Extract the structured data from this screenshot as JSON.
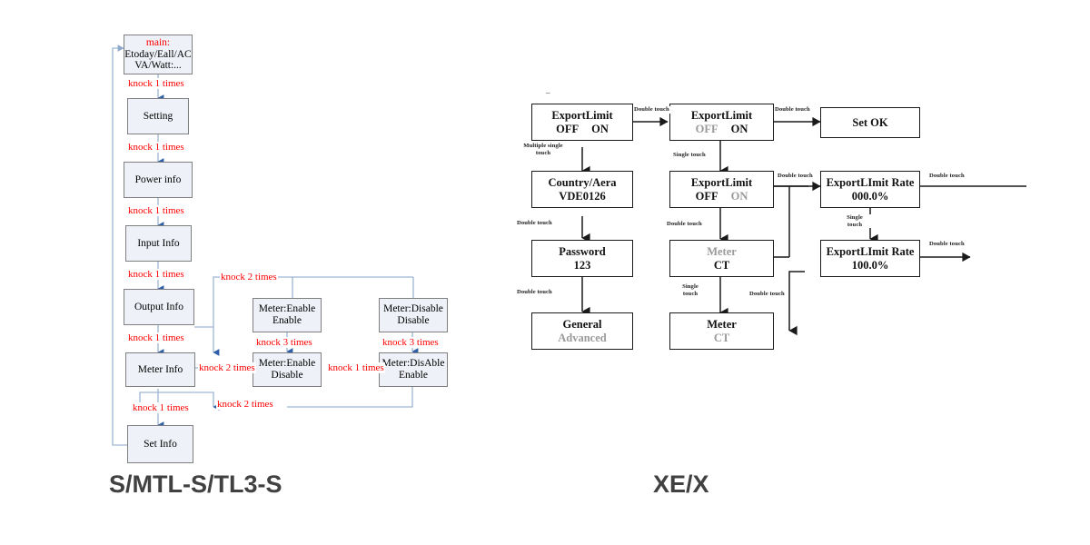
{
  "titles": {
    "left": "S/MTL-S/TL3-S",
    "right": "XE/X"
  },
  "left_chart": {
    "name": "S/MTL-S/TL3-S menu navigation flow",
    "boxes": [
      {
        "id": "main",
        "line1": "main:",
        "line2": "Etoday/Eall/AC",
        "line3": "VA/Watt:...",
        "line1_color": "#ff0000"
      },
      {
        "id": "setting",
        "line1": "Setting",
        "line2": "",
        "line3": ""
      },
      {
        "id": "power-info",
        "line1": "Power info",
        "line2": "",
        "line3": ""
      },
      {
        "id": "input-info",
        "line1": "Input Info",
        "line2": "",
        "line3": ""
      },
      {
        "id": "output-info",
        "line1": "Output Info",
        "line2": "",
        "line3": ""
      },
      {
        "id": "meter-info",
        "line1": "Meter  Info",
        "line2": "",
        "line3": ""
      },
      {
        "id": "set-info",
        "line1": "Set Info",
        "line2": "",
        "line3": ""
      },
      {
        "id": "meter-enable-enable",
        "line1": "Meter:Enable",
        "line2": "Enable",
        "line3": ""
      },
      {
        "id": "meter-enable-disable",
        "line1": "Meter:Enable",
        "line2": "Disable",
        "line3": ""
      },
      {
        "id": "meter-disable-disable",
        "line1": "Meter:Disable",
        "line2": "Disable",
        "line3": ""
      },
      {
        "id": "meter-disable-enable",
        "line1": "Meter:DisAble",
        "line2": "Enable",
        "line3": ""
      }
    ],
    "edge_labels": [
      {
        "id": "main-to-setting",
        "text": "knock 1 times"
      },
      {
        "id": "setting-to-power",
        "text": "knock 1 times"
      },
      {
        "id": "power-to-input",
        "text": "knock 1 times"
      },
      {
        "id": "input-to-output",
        "text": "knock 1 times"
      },
      {
        "id": "output-to-meter",
        "text": "knock 1 times"
      },
      {
        "id": "meter-to-set",
        "text": "knock 1 times"
      },
      {
        "id": "top-branch",
        "text": "knock 2 times"
      },
      {
        "id": "meterinfo-to-enabledisable",
        "text": "knock 2 times"
      },
      {
        "id": "enabledisable-to-disable",
        "text": "knock 1 times"
      },
      {
        "id": "enabledisable-up",
        "text": "knock 3 times"
      },
      {
        "id": "disableenable-up",
        "text": "knock 3 times"
      },
      {
        "id": "bottom-return",
        "text": "knock 2 times"
      }
    ],
    "accent_color": "#ff0000",
    "wire_color": "#9fb6d4",
    "box_fill": "#eef1f7",
    "box_border": "#7f7f7f"
  },
  "right_chart": {
    "name": "XE/X export limit setting flow",
    "boxes": [
      {
        "id": "exportlimit-1",
        "line1": "ExportLimit",
        "off": "OFF",
        "on": "ON",
        "off_dim": false,
        "on_dim": false
      },
      {
        "id": "exportlimit-2",
        "line1": "ExportLimit",
        "off": "OFF",
        "on": "ON",
        "off_dim": true,
        "on_dim": false
      },
      {
        "id": "set-ok",
        "line1": "Set OK",
        "line2": ""
      },
      {
        "id": "country-aera",
        "line1": "Country/Aera",
        "line2": "VDE0126"
      },
      {
        "id": "exportlimit-3",
        "line1": "ExportLimit",
        "off": "OFF",
        "on": "ON",
        "off_dim": false,
        "on_dim": true
      },
      {
        "id": "rate-000",
        "line1": "ExportLImit Rate",
        "line2": "000.0%"
      },
      {
        "id": "password",
        "line1": "Password",
        "line2": "123",
        "line2_dim": false
      },
      {
        "id": "meter-ct-1",
        "line1": "Meter",
        "line2": "CT",
        "line1_dim": true
      },
      {
        "id": "rate-100",
        "line1": "ExportLImit Rate",
        "line2": "100.0%"
      },
      {
        "id": "general-advanced",
        "line1": "General",
        "line2": "Advanced",
        "line2_dim": true
      },
      {
        "id": "meter-ct-2",
        "line1": "Meter",
        "line2": "CT",
        "line2_dim": true
      }
    ],
    "edge_labels": [
      {
        "id": "e1-to-e2",
        "text": "Double touch"
      },
      {
        "id": "e2-to-setok",
        "text": "Double touch"
      },
      {
        "id": "country-to-e1",
        "text": "Multiple single\ntouch"
      },
      {
        "id": "e2-to-e3",
        "text": "Single touch"
      },
      {
        "id": "password-to-country",
        "text": "Double touch"
      },
      {
        "id": "e3-to-meter",
        "text": "Double touch"
      },
      {
        "id": "e3-to-rate",
        "text": "Double touch"
      },
      {
        "id": "rate000-out",
        "text": "Double touch"
      },
      {
        "id": "rate000-to-rate100",
        "text": "Single\ntouch"
      },
      {
        "id": "rate100-out",
        "text": "Double touch"
      },
      {
        "id": "general-to-password",
        "text": "Double touch"
      },
      {
        "id": "meter1-to-meter2",
        "text": "Single\ntouch"
      },
      {
        "id": "meter2-to-rate",
        "text": "Double touch"
      }
    ],
    "wire_color": "#1a1a1a",
    "dim_color": "#9a9a9a"
  }
}
